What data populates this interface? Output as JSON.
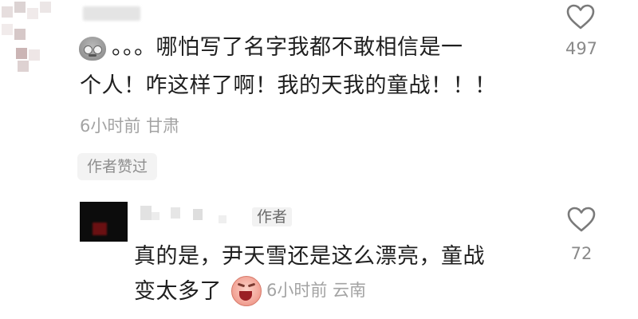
{
  "comment": {
    "emoji": "gray-sweat-face-emoji",
    "text_line1": "。。。哪怕写了名字我都不敢相信是一",
    "text_line2": "个人！咋这样了啊！我的天我的童战！！！",
    "meta": "6小时前 甘肃",
    "liked_badge": "作者赞过",
    "like_count": "497"
  },
  "reply": {
    "author_tag": "作者",
    "text_line1": "真的是，尹天雪还是这么漂亮，童战",
    "text_line2": "变太多了",
    "emoji": "crying-face-emoji",
    "meta": "6小时前 云南",
    "like_count": "72"
  },
  "colors": {
    "text": "#1f1f1f",
    "meta": "#a3a3a3",
    "badge_bg": "#f3f3f3",
    "avatar_reply": "#0c0c0c",
    "heart_outline": "#7a7a7a"
  },
  "icons": [
    "heart-outline-icon",
    "heart-outline-icon"
  ]
}
